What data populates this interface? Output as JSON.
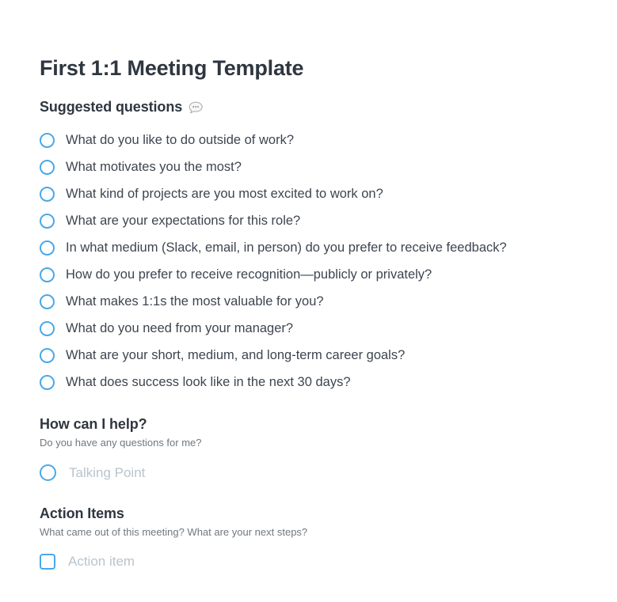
{
  "document": {
    "title": "First 1:1 Meeting Template"
  },
  "suggested": {
    "heading": "Suggested questions",
    "comment_icon": "speech-bubble-icon",
    "questions": [
      "What do you like to do outside of work?",
      "What motivates you the most?",
      "What kind of projects are you most excited to work on?",
      "What are your expectations for this role?",
      "In what medium (Slack, email, in person) do you prefer to receive feedback?",
      "How do you prefer to receive recognition—publicly or privately?",
      "What makes 1:1s the most valuable for you?",
      "What do you need from your manager?",
      "What are your short, medium, and long-term career goals?",
      "What does success look like in the next 30 days?"
    ]
  },
  "how_can_i_help": {
    "title": "How can I help?",
    "description": "Do you have any questions for me?",
    "placeholder": "Talking Point"
  },
  "action_items": {
    "title": "Action Items",
    "description": "What came out of this meeting? What are your next steps?",
    "placeholder": "Action item"
  },
  "colors": {
    "accent": "#4aa8e8",
    "text": "#3d4550",
    "heading": "#2f3640",
    "muted": "#70787f",
    "placeholder": "#b9c4cc",
    "background": "#ffffff"
  }
}
